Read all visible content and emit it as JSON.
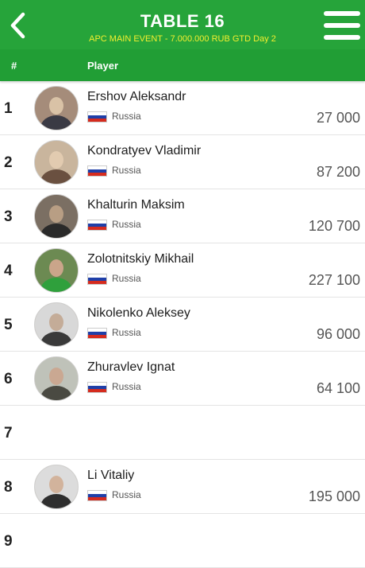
{
  "header": {
    "title": "TABLE 16",
    "subtitle": "APC MAIN EVENT - 7.000.000 RUB GTD Day 2",
    "back_icon": "chevron-left-icon",
    "menu_icon": "hamburger-menu-icon"
  },
  "columns": {
    "num": "#",
    "player": "Player"
  },
  "colors": {
    "brand_green": "#26a43a",
    "subtitle_yellow": "#f3ef2f"
  },
  "seats": [
    {
      "num": "1",
      "name": "Ershov Aleksandr",
      "country": "Russia",
      "chips": "27 000",
      "occupied": true
    },
    {
      "num": "2",
      "name": "Kondratyev Vladimir",
      "country": "Russia",
      "chips": "87 200",
      "occupied": true
    },
    {
      "num": "3",
      "name": "Khalturin Maksim",
      "country": "Russia",
      "chips": "120 700",
      "occupied": true
    },
    {
      "num": "4",
      "name": "Zolotnitskiy Mikhail",
      "country": "Russia",
      "chips": "227 100",
      "occupied": true
    },
    {
      "num": "5",
      "name": "Nikolenko Aleksey",
      "country": "Russia",
      "chips": "96 000",
      "occupied": true
    },
    {
      "num": "6",
      "name": "Zhuravlev Ignat",
      "country": "Russia",
      "chips": "64 100",
      "occupied": true
    },
    {
      "num": "7",
      "occupied": false
    },
    {
      "num": "8",
      "name": "Li Vitaliy",
      "country": "Russia",
      "chips": "195 000",
      "occupied": true
    },
    {
      "num": "9",
      "occupied": false
    }
  ]
}
